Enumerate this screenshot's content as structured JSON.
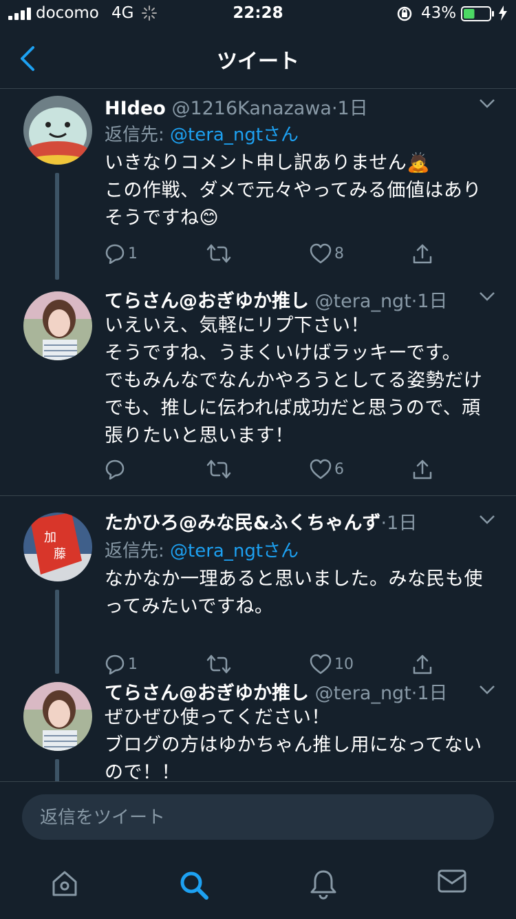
{
  "status_bar": {
    "carrier": "docomo",
    "network": "4G",
    "time": "22:28",
    "battery_percent": "43%",
    "battery_level": 0.43,
    "battery_color": "#4cd964"
  },
  "header": {
    "title": "ツイート",
    "back_icon": "chevron-left-icon",
    "accent_color": "#1da1f2"
  },
  "tweets": [
    {
      "name": "HIdeo",
      "handle": "@1216Kanazawa",
      "dot": "·",
      "time": "1日",
      "reply_prefix": "返信先: ",
      "reply_to": "@tera_ngtさん",
      "text_lines": [
        "いきなりコメント申し訳ありません🙇",
        "この作戦、ダメで元々やってみる価値はあり",
        "そうですね😊"
      ],
      "replies": "1",
      "retweets": "",
      "likes": "8"
    },
    {
      "name": "てらさん@おぎゆか推し",
      "handle": "@tera_ngt",
      "dot": "·",
      "time": "1日",
      "text_lines": [
        "いえいえ、気軽にリプ下さい！",
        "そうですね、うまくいけばラッキーです。",
        "でもみんなでなんかやろうとしてる姿勢だけ",
        "でも、推しに伝われば成功だと思うので、頑",
        "張りたいと思います！"
      ],
      "replies": "",
      "retweets": "",
      "likes": "6"
    },
    {
      "name": "たかひろ@みな民&ふくちゃんず",
      "handle": "",
      "dot": "·",
      "time": "1日",
      "reply_prefix": "返信先: ",
      "reply_to": "@tera_ngtさん",
      "text_lines": [
        "なかなか一理あると思いました。みな民も使",
        "ってみたいですね。"
      ],
      "replies": "1",
      "retweets": "",
      "likes": "10"
    },
    {
      "name": "てらさん@おぎゆか推し",
      "handle": "@tera_ngt",
      "dot": "·",
      "time": "1日",
      "text_lines": [
        "ぜひぜひ使ってください！",
        "ブログの方はゆかちゃん推し用になってない",
        "ので！！"
      ]
    }
  ],
  "composer": {
    "placeholder": "返信をツイート"
  },
  "tab_bar": {
    "tabs": [
      "home-icon",
      "search-icon",
      "notifications-icon",
      "messages-icon"
    ],
    "active": "search-icon"
  }
}
